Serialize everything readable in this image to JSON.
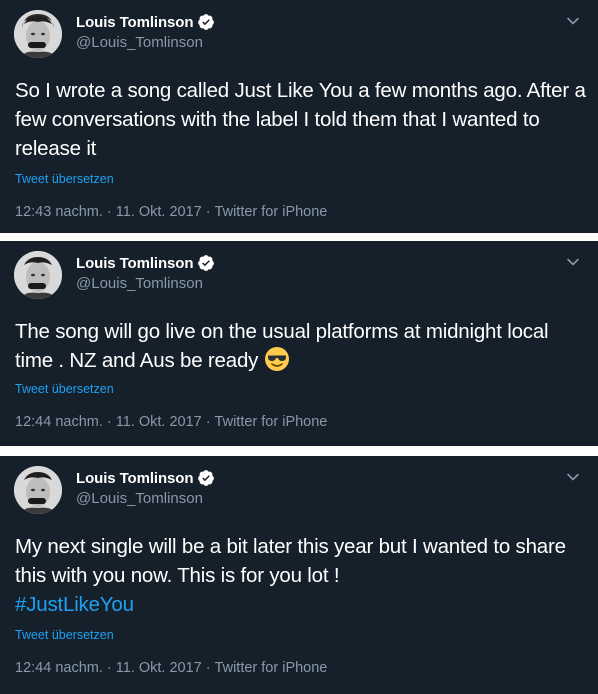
{
  "tweets": [
    {
      "display_name": "Louis Tomlinson",
      "handle": "@Louis_Tomlinson",
      "text": "So I wrote a song called Just Like You  a few months ago. After a few conversations with the label I told them that I wanted to release it",
      "translate_label": "Tweet übersetzen",
      "time": "12:43 nachm.",
      "date": "11. Okt. 2017",
      "source": "Twitter for iPhone"
    },
    {
      "display_name": "Louis Tomlinson",
      "handle": "@Louis_Tomlinson",
      "text": "The song will go live on the usual platforms at midnight local time . NZ and Aus be ready",
      "emoji_icon": "smiling-face-with-sunglasses-icon",
      "translate_label": "Tweet übersetzen",
      "time": "12:44 nachm.",
      "date": "11. Okt. 2017",
      "source": "Twitter for iPhone"
    },
    {
      "display_name": "Louis Tomlinson",
      "handle": "@Louis_Tomlinson",
      "text": "My next single will be a bit later this year but I wanted to share this with you now. This is for you lot !",
      "hashtag": "#JustLikeYou",
      "translate_label": "Tweet übersetzen",
      "time": "12:44 nachm.",
      "date": "11. Okt. 2017",
      "source": "Twitter for iPhone"
    }
  ],
  "meta_separator": "·",
  "colors": {
    "background": "#15202b",
    "text": "#ffffff",
    "secondary": "#8899a6",
    "accent": "#1da1f2",
    "divider": "#ffffff"
  },
  "icons": [
    "avatar",
    "verified-badge-icon",
    "chevron-down-icon"
  ]
}
